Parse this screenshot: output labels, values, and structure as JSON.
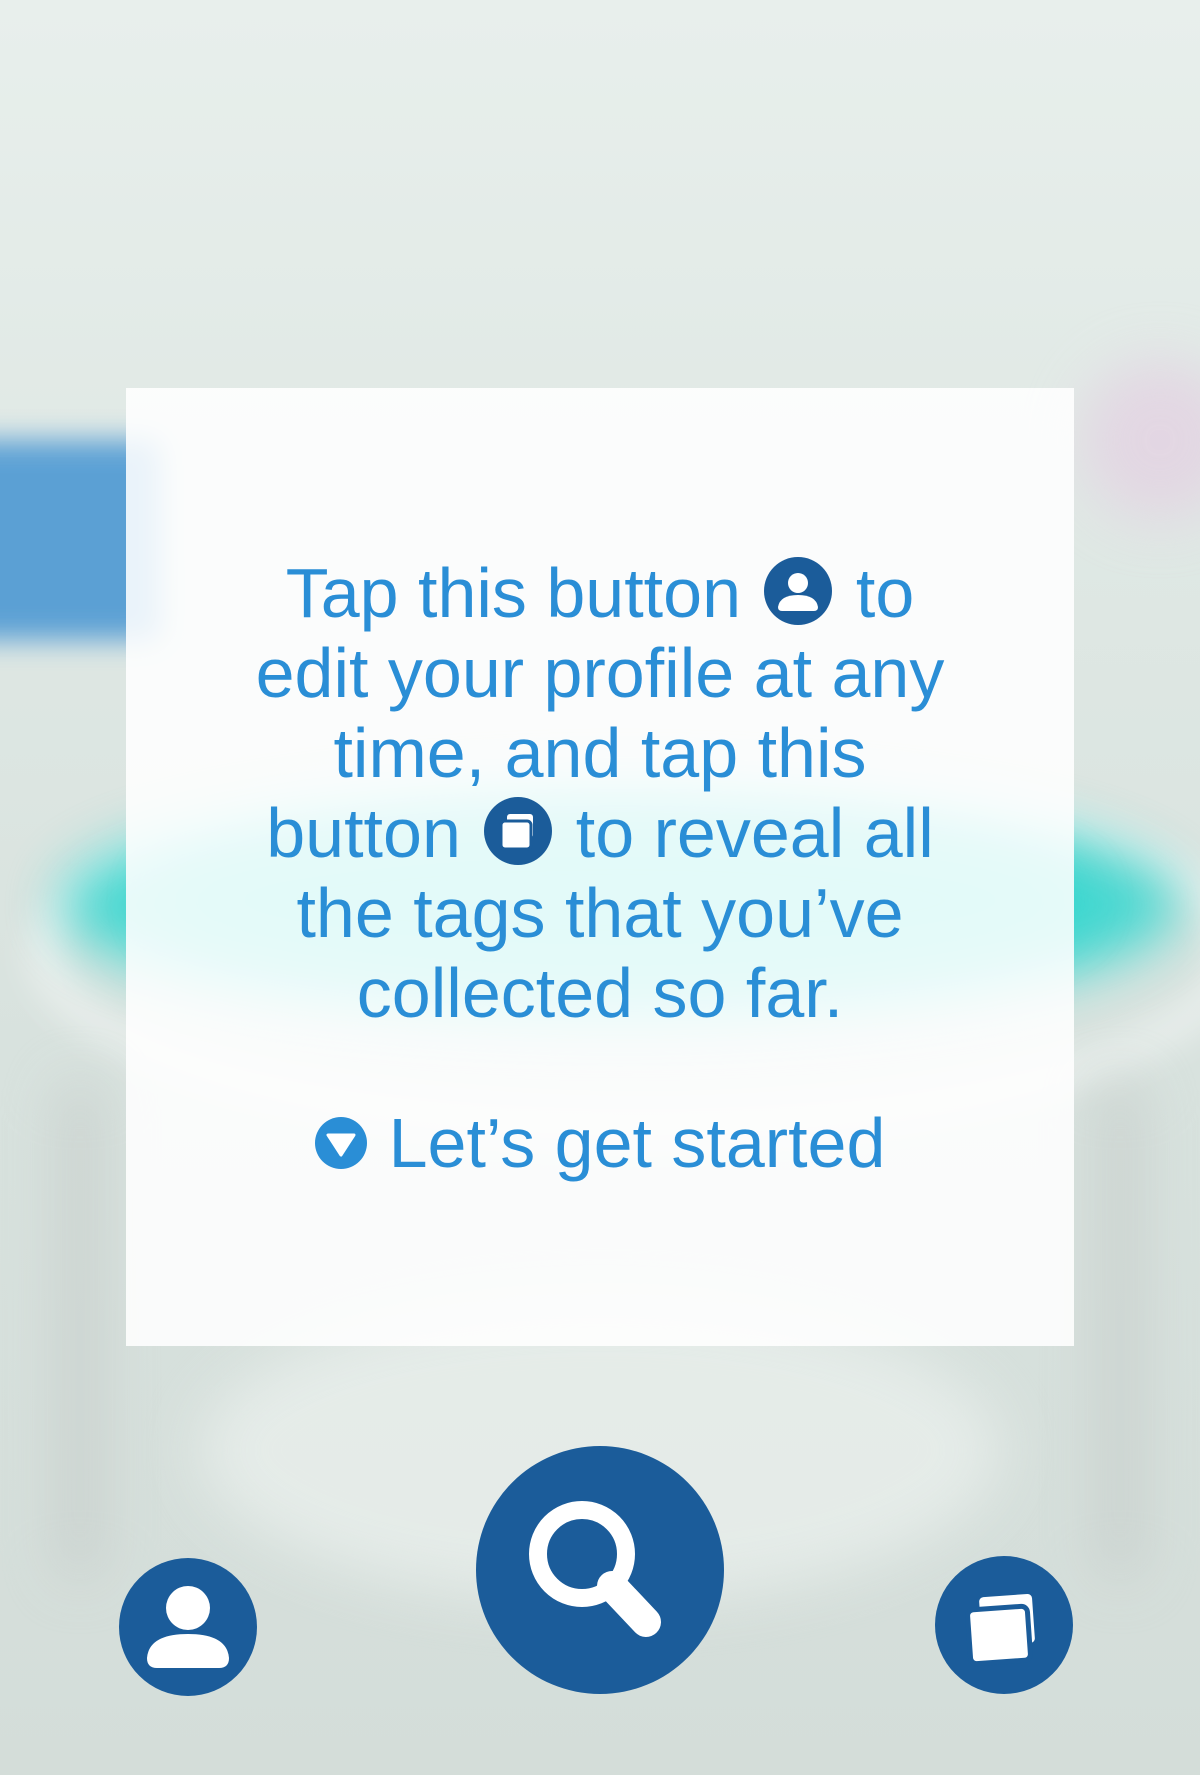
{
  "background": {
    "description_icon": "blurred-camera-view"
  },
  "onboarding": {
    "line1_before": "Tap this button",
    "line1_after": "to",
    "line2": "edit your profile at any",
    "line3": "time, and tap this",
    "line4_before": "button",
    "line4_after": "to reveal all",
    "line5": "the tags that you’ve",
    "line6": "collected so far.",
    "cta_label": "Let’s get started",
    "inline_icon_1": "profile-icon",
    "inline_icon_2": "tags-stack-icon",
    "cta_icon": "down-triangle-icon"
  },
  "toolbar": {
    "profile_icon": "profile-icon",
    "search_icon": "search-icon",
    "tags_icon": "tags-stack-icon"
  },
  "colors": {
    "accent_text": "#2a8ed6",
    "button_fill": "#1b5c9a",
    "card_bg": "#ffffff"
  }
}
